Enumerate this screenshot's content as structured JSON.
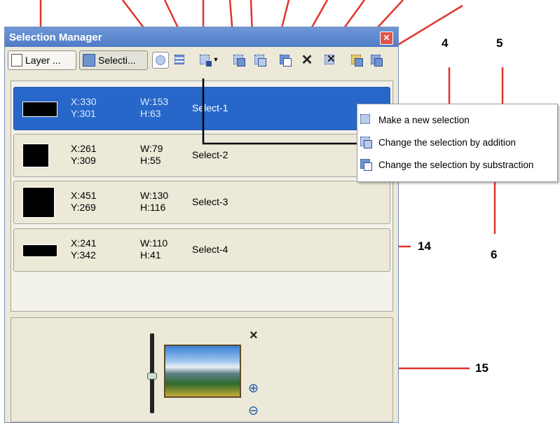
{
  "window": {
    "title": "Selection Manager",
    "close_glyph": "✕"
  },
  "toolbar": {
    "layer_button": "Layer ...",
    "selection_button": "Selecti...",
    "icons": [
      "zoom-selection-icon",
      "grid-selection-icon",
      "new-selection-dropdown-icon",
      "dropdown-arrow-icon",
      "intersect-icon",
      "add-selection-icon",
      "subtract-selection-icon",
      "delete-icon",
      "delete-all-icon",
      "load-selection-icon",
      "save-selection-icon"
    ]
  },
  "selections": [
    {
      "x": "X:330",
      "y": "Y:301",
      "w": "W:153",
      "h": "H:63",
      "name": "Select-1",
      "selected": true
    },
    {
      "x": "X:261",
      "y": "Y:309",
      "w": "W:79",
      "h": "H:55",
      "name": "Select-2",
      "selected": false
    },
    {
      "x": "X:451",
      "y": "Y:269",
      "w": "W:130",
      "h": "H:116",
      "name": "Select-3",
      "selected": false
    },
    {
      "x": "X:241",
      "y": "Y:342",
      "w": "W:110",
      "h": "H:41",
      "name": "Select-4",
      "selected": false
    }
  ],
  "context_menu": [
    "Make a new selection",
    "Change the selection by addition",
    "Change the selection by substraction"
  ],
  "preview": {
    "close_glyph": "×",
    "zoom_in": "⊕",
    "zoom_out": "⊖"
  },
  "callouts": {
    "c4": "4",
    "c5": "5",
    "c6": "6",
    "c14": "14",
    "c15": "15"
  },
  "colors": {
    "selected_row": "#2667c9",
    "annotation_line": "#e0342c",
    "window_bg": "#ece9d8"
  }
}
